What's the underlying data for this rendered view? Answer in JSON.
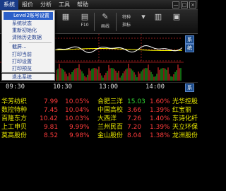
{
  "menubar": {
    "items": [
      "系统",
      "报价",
      "分析",
      "工具",
      "帮助"
    ],
    "active_index": 0,
    "window_controls": [
      "×",
      "□",
      "—"
    ]
  },
  "toolbar": {
    "buttons": [
      {
        "label": "F10",
        "icon": "f10-icon"
      },
      {
        "label": "画线",
        "icon": "draw-line-icon"
      },
      {
        "label": "特种",
        "icon": "special-icon"
      },
      {
        "label": "指标",
        "icon": "indicator-icon"
      }
    ]
  },
  "dropdown": {
    "items": [
      {
        "label": "Level2账号设置",
        "highlight": true
      },
      {
        "label": "系统状态"
      },
      {
        "label": "重新初始化"
      },
      {
        "label": "清除历史数据"
      },
      {
        "label": "截屏..."
      },
      {
        "label": "打印当前"
      },
      {
        "label": "打印设置"
      },
      {
        "label": "打印预览"
      },
      {
        "label": "退出系统"
      }
    ]
  },
  "chart": {
    "side_labels": [
      "系",
      "统",
      "系"
    ],
    "time_labels": [
      "09:30",
      "10:30",
      "13:00",
      "14:00"
    ],
    "colors": {
      "price": "#ffffff",
      "avg": "#ffff00",
      "up": "#ff3030",
      "down": "#22cc22",
      "grid": "#8b1a1a"
    }
  },
  "stocks": {
    "rows": [
      {
        "name": "华芳纺织",
        "price": "7.99",
        "pct": "10.05%",
        "name2": "合肥三洋",
        "price2": "15.03",
        "pct2": "1.60%",
        "name3": "光华控股"
      },
      {
        "name": "数控特种",
        "price": "7.45",
        "pct": "10.04%",
        "name2": "中国高校",
        "price2": "3.66",
        "pct2": "1.39%",
        "name3": "红宝丽"
      },
      {
        "name": "百隆东方",
        "price": "10.42",
        "pct": "10.03%",
        "name2": "大西洋",
        "price2": "7.26",
        "pct2": "1.40%",
        "name3": "东诗化纤"
      },
      {
        "name": "上工申贝",
        "price": "9.81",
        "pct": "9.99%",
        "name2": "兰州民百",
        "price2": "7.20",
        "pct2": "1.39%",
        "name3": "天立环保"
      },
      {
        "name": "莫高股份",
        "price": "8.52",
        "pct": "9.98%",
        "name2": "金山股份",
        "price2": "8.04",
        "pct2": "1.38%",
        "name3": "龙洲股份"
      }
    ]
  }
}
